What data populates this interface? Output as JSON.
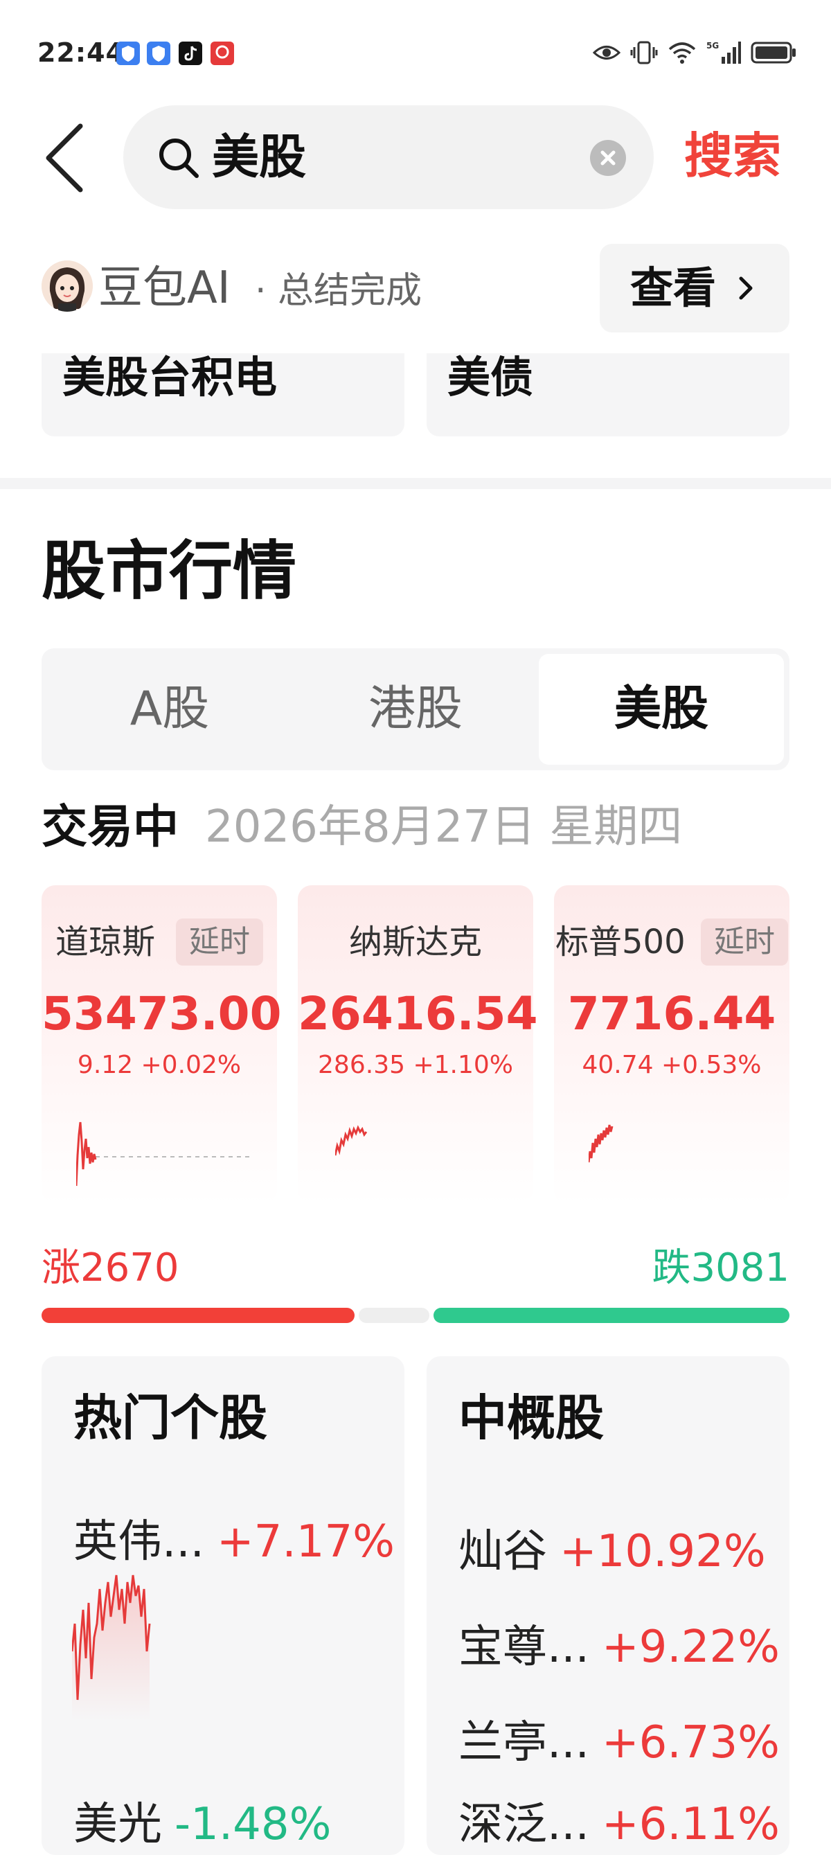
{
  "status_bar": {
    "time": "22:44",
    "app_icons": [
      "app-shield-icon",
      "app-shield-icon",
      "tiktok-icon",
      "app-badge-icon"
    ],
    "indicators": [
      "eye-icon",
      "vibrate-icon",
      "wifi-icon",
      "signal-5g-icon",
      "battery-icon"
    ]
  },
  "header": {
    "search_query": "美股",
    "search_button": "搜索"
  },
  "ai_summary": {
    "name": "豆包AI",
    "status": "· 总结完成",
    "view_label": "查看"
  },
  "related": [
    "美股台积电",
    "美债"
  ],
  "market": {
    "title": "股市行情",
    "tabs": [
      "A股",
      "港股",
      "美股"
    ],
    "active_tab": 2,
    "trade_status": "交易中",
    "date": "2026年8月27日 星期四"
  },
  "indices": [
    {
      "name": "道琼斯",
      "tag": "延时",
      "value": "53473.00",
      "change": "9.12 +0.02%"
    },
    {
      "name": "纳斯达克",
      "tag": "",
      "value": "26416.54",
      "change": "286.35 +1.10%"
    },
    {
      "name": "标普500",
      "tag": "延时",
      "value": "7716.44",
      "change": "40.74 +0.53%"
    }
  ],
  "breadth": {
    "rise_label": "涨2670",
    "fall_label": "跌3081",
    "rise_count": 2670,
    "fall_count": 3081
  },
  "hot_stocks": {
    "title": "热门个股",
    "items": [
      {
        "name": "英伟...",
        "pct": "+7.17%"
      },
      {
        "name": "美光",
        "pct": "-1.48%"
      }
    ]
  },
  "china_stocks": {
    "title": "中概股",
    "items": [
      {
        "name": "灿谷",
        "pct": "+10.92%"
      },
      {
        "name": "宝尊...",
        "pct": "+9.22%"
      },
      {
        "name": "兰亭...",
        "pct": "+6.73%"
      },
      {
        "name": "深泛...",
        "pct": "+6.11%"
      }
    ]
  },
  "colors": {
    "up": "#ec3a3a",
    "down": "#22b985",
    "accent": "#f0433a"
  }
}
